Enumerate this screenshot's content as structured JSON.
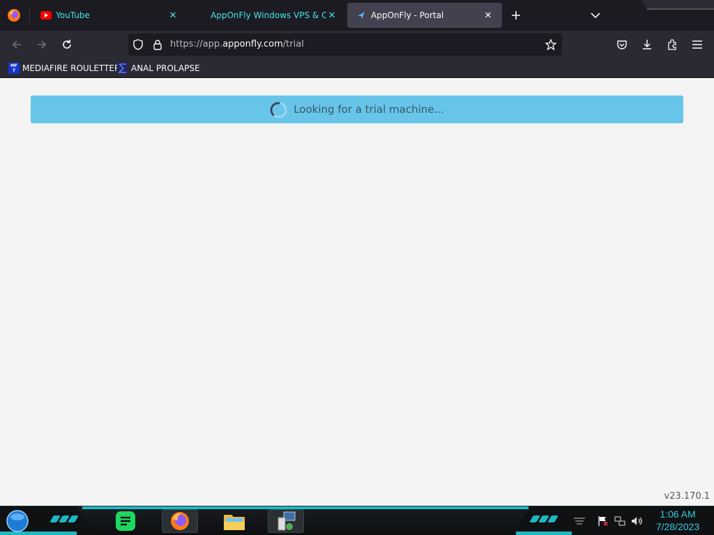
{
  "browser": {
    "tabs": [
      {
        "title": "YouTube",
        "favicon": "youtube-icon",
        "active": false
      },
      {
        "title": "AppOnFly Windows VPS & Cloud",
        "favicon": "none",
        "active": false
      },
      {
        "title": "AppOnFly - Portal",
        "favicon": "apponfly-icon",
        "active": true
      }
    ],
    "url": {
      "prefix": "https://app.",
      "host": "apponfly.com",
      "path": "/trial"
    },
    "bookmarks": [
      {
        "label": "MEDIAFIRE ROULETTER",
        "icon": "mft-icon",
        "icon_text": [
          "MF",
          "T"
        ]
      },
      {
        "label": "ANAL PROLAPSE",
        "icon": "sigma-icon"
      }
    ]
  },
  "page": {
    "status_message": "Looking for a trial machine...",
    "version": "v23.170.1"
  },
  "taskbar": {
    "apps": [
      "start-orb",
      "notes-app",
      "firefox",
      "file-explorer",
      "network-tool"
    ],
    "clock": {
      "time": "1:06 AM",
      "date": "7/28/2023"
    }
  },
  "colors": {
    "alert_bg": "#67c5ea",
    "tab_text": "#42e6e6",
    "taskbar_accent": "#1fb7c4"
  }
}
